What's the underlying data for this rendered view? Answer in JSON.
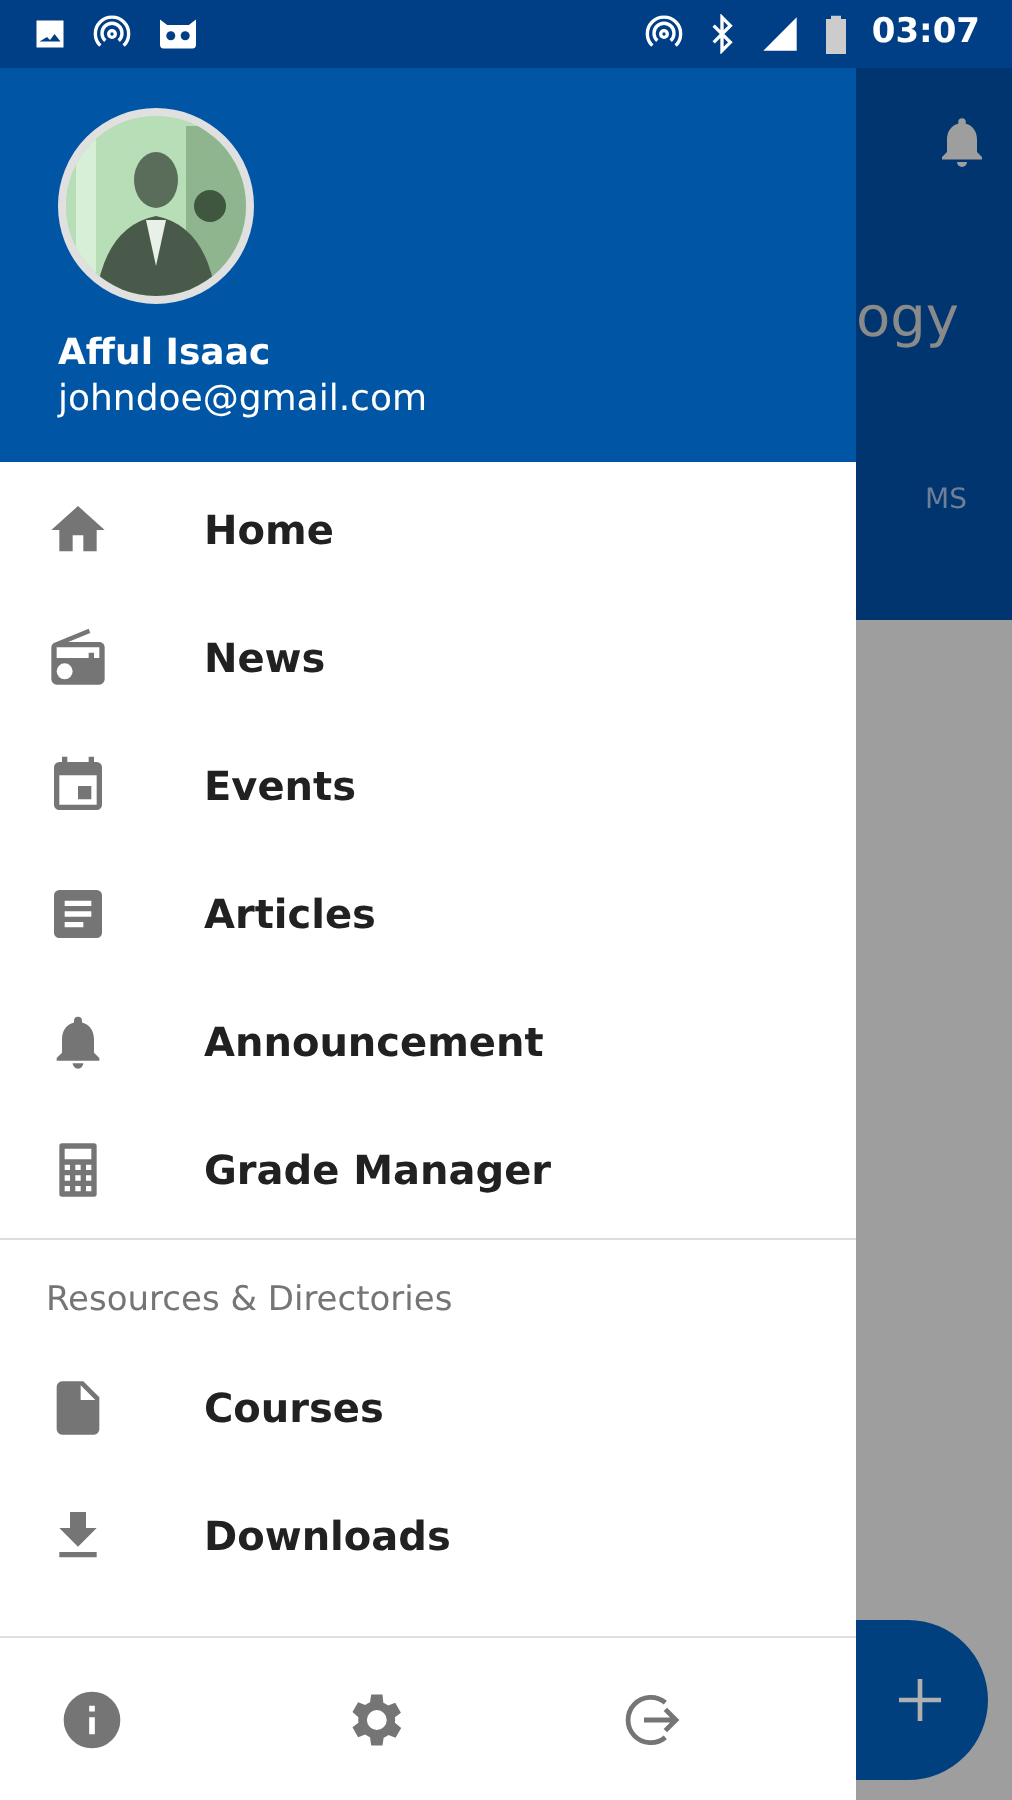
{
  "status_bar": {
    "time": "03:07"
  },
  "background_app": {
    "title_fragment": "ogy",
    "tab_fragment": "MS"
  },
  "profile": {
    "name": "Afful Isaac",
    "email": "johndoe@gmail.com"
  },
  "menu": [
    {
      "label": "Home"
    },
    {
      "label": "News"
    },
    {
      "label": "Events"
    },
    {
      "label": "Articles"
    },
    {
      "label": "Announcement"
    },
    {
      "label": "Grade Manager"
    }
  ],
  "section": {
    "title": "Resources & Directories",
    "items": [
      {
        "label": "Courses"
      },
      {
        "label": "Downloads"
      }
    ]
  }
}
